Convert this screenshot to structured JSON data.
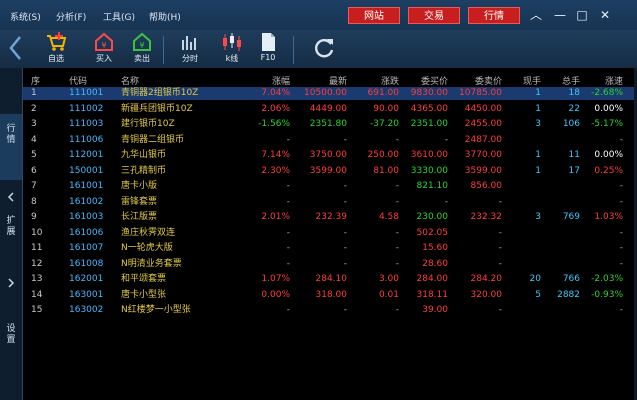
{
  "menu": [
    {
      "label": "系统(S)"
    },
    {
      "label": "分析(F)"
    },
    {
      "label": "工具(G)"
    },
    {
      "label": "帮助(H)"
    }
  ],
  "title_buttons": [
    {
      "label": "网站"
    },
    {
      "label": "交易"
    },
    {
      "label": "行情"
    }
  ],
  "window_controls": {
    "collapse": "︿",
    "minimize": "—",
    "maximize": "□",
    "close": "✕"
  },
  "toolbar": {
    "back_icon": "back-arrow-icon",
    "tools": [
      {
        "label": "自选",
        "icon": "cart-icon"
      },
      {
        "label": "买入",
        "icon": "buy-icon"
      },
      {
        "label": "卖出",
        "icon": "sell-icon"
      },
      {
        "label": "分时",
        "icon": "timeshare-icon"
      },
      {
        "label": "k线",
        "icon": "candlestick-icon"
      },
      {
        "label": "F10",
        "icon": "f10-document-icon"
      }
    ],
    "refresh_icon": "refresh-icon"
  },
  "side_tabs": [
    {
      "label": "行\n情"
    },
    {
      "label": "扩\n展"
    },
    {
      "label": "设\n置"
    }
  ],
  "colors": {
    "red": "#ff3d3d",
    "green": "#2bd42b",
    "selected_row": "#1a3a70",
    "title_button": "#c81e1e"
  },
  "table": {
    "headers": [
      "序",
      "代码",
      "名称",
      "涨幅",
      "最新",
      "涨跌",
      "委买价",
      "委卖价",
      "现手",
      "总手",
      "涨速"
    ],
    "rows": [
      {
        "seq": "1",
        "code": "111001",
        "name": "青铜器2组银币10Z",
        "pct": "7.04%",
        "last": "10500.00",
        "chg": "691.00",
        "bid": "9830.00",
        "ask": "10785.00",
        "vol": "1",
        "tot": "18",
        "spd": "-2.68%",
        "pct_c": "red",
        "last_c": "red",
        "chg_c": "red",
        "bid_c": "red",
        "ask_c": "red",
        "spd_c": "green",
        "tot_c": "cyan",
        "selected": true
      },
      {
        "seq": "2",
        "code": "111002",
        "name": "新疆兵团银币10Z",
        "pct": "2.06%",
        "last": "4449.00",
        "chg": "90.00",
        "bid": "4365.00",
        "ask": "4450.00",
        "vol": "1",
        "tot": "22",
        "spd": "0.00%",
        "pct_c": "red",
        "last_c": "red",
        "chg_c": "red",
        "bid_c": "red",
        "ask_c": "red",
        "spd_c": "white",
        "tot_c": "cyan"
      },
      {
        "seq": "3",
        "code": "111003",
        "name": "建行银币10Z",
        "pct": "-1.56%",
        "last": "2351.80",
        "chg": "-37.20",
        "bid": "2351.00",
        "ask": "2455.00",
        "vol": "3",
        "tot": "106",
        "spd": "-5.17%",
        "pct_c": "green",
        "last_c": "green",
        "chg_c": "green",
        "bid_c": "green",
        "ask_c": "red",
        "spd_c": "green",
        "tot_c": "cyan"
      },
      {
        "seq": "4",
        "code": "111006",
        "name": "青铜器二组银币",
        "pct": "-",
        "last": "-",
        "chg": "-",
        "bid": "-",
        "ask": "2487.00",
        "vol": "",
        "tot": "",
        "spd": "-",
        "pct_c": "gray",
        "last_c": "gray",
        "chg_c": "gray",
        "bid_c": "gray",
        "ask_c": "red",
        "spd_c": "gray",
        "tot_c": "cyan"
      },
      {
        "seq": "5",
        "code": "112001",
        "name": "九华山银币",
        "pct": "7.14%",
        "last": "3750.00",
        "chg": "250.00",
        "bid": "3610.00",
        "ask": "3770.00",
        "vol": "1",
        "tot": "11",
        "spd": "0.00%",
        "pct_c": "red",
        "last_c": "red",
        "chg_c": "red",
        "bid_c": "red",
        "ask_c": "red",
        "spd_c": "white",
        "tot_c": "cyan"
      },
      {
        "seq": "6",
        "code": "150001",
        "name": "三孔精制币",
        "pct": "2.30%",
        "last": "3599.00",
        "chg": "81.00",
        "bid": "3330.00",
        "ask": "3599.00",
        "vol": "1",
        "tot": "17",
        "spd": "0.25%",
        "pct_c": "red",
        "last_c": "red",
        "chg_c": "red",
        "bid_c": "green",
        "ask_c": "red",
        "spd_c": "red",
        "tot_c": "cyan"
      },
      {
        "seq": "7",
        "code": "161001",
        "name": "唐卡小版",
        "pct": "-",
        "last": "-",
        "chg": "-",
        "bid": "821.10",
        "ask": "856.00",
        "vol": "",
        "tot": "",
        "spd": "-",
        "pct_c": "gray",
        "last_c": "gray",
        "chg_c": "gray",
        "bid_c": "green",
        "ask_c": "red",
        "spd_c": "gray",
        "tot_c": "cyan"
      },
      {
        "seq": "8",
        "code": "161002",
        "name": "雷锋套票",
        "pct": "-",
        "last": "-",
        "chg": "-",
        "bid": "-",
        "ask": "-",
        "vol": "",
        "tot": "",
        "spd": "-",
        "pct_c": "gray",
        "last_c": "gray",
        "chg_c": "gray",
        "bid_c": "gray",
        "ask_c": "gray",
        "spd_c": "gray",
        "tot_c": "cyan"
      },
      {
        "seq": "9",
        "code": "161003",
        "name": "长江版票",
        "pct": "2.01%",
        "last": "232.39",
        "chg": "4.58",
        "bid": "230.00",
        "ask": "232.32",
        "vol": "3",
        "tot": "769",
        "spd": "1.03%",
        "pct_c": "red",
        "last_c": "red",
        "chg_c": "red",
        "bid_c": "green",
        "ask_c": "red",
        "spd_c": "red",
        "tot_c": "cyan"
      },
      {
        "seq": "10",
        "code": "161006",
        "name": "渔庄秋霁双连",
        "pct": "-",
        "last": "-",
        "chg": "-",
        "bid": "502.05",
        "ask": "-",
        "vol": "",
        "tot": "",
        "spd": "-",
        "pct_c": "gray",
        "last_c": "gray",
        "chg_c": "gray",
        "bid_c": "red",
        "ask_c": "gray",
        "spd_c": "gray",
        "tot_c": "cyan"
      },
      {
        "seq": "11",
        "code": "161007",
        "name": "N一轮虎大版",
        "pct": "-",
        "last": "-",
        "chg": "-",
        "bid": "15.60",
        "ask": "-",
        "vol": "",
        "tot": "",
        "spd": "-",
        "pct_c": "gray",
        "last_c": "gray",
        "chg_c": "gray",
        "bid_c": "red",
        "ask_c": "gray",
        "spd_c": "gray",
        "tot_c": "cyan"
      },
      {
        "seq": "12",
        "code": "161008",
        "name": "N明清业务套票",
        "pct": "-",
        "last": "-",
        "chg": "-",
        "bid": "28.60",
        "ask": "-",
        "vol": "",
        "tot": "",
        "spd": "-",
        "pct_c": "gray",
        "last_c": "gray",
        "chg_c": "gray",
        "bid_c": "red",
        "ask_c": "gray",
        "spd_c": "gray",
        "tot_c": "cyan"
      },
      {
        "seq": "13",
        "code": "162001",
        "name": "和平颂套票",
        "pct": "1.07%",
        "last": "284.10",
        "chg": "3.00",
        "bid": "284.00",
        "ask": "284.20",
        "vol": "20",
        "tot": "766",
        "spd": "-2.03%",
        "pct_c": "red",
        "last_c": "red",
        "chg_c": "red",
        "bid_c": "red",
        "ask_c": "red",
        "spd_c": "green",
        "tot_c": "cyan"
      },
      {
        "seq": "14",
        "code": "163001",
        "name": "唐卡小型张",
        "pct": "0.00%",
        "last": "318.00",
        "chg": "0.01",
        "bid": "318.11",
        "ask": "320.00",
        "vol": "5",
        "tot": "2882",
        "spd": "-0.93%",
        "pct_c": "red",
        "last_c": "red",
        "chg_c": "red",
        "bid_c": "red",
        "ask_c": "red",
        "spd_c": "green",
        "tot_c": "cyan"
      },
      {
        "seq": "15",
        "code": "163002",
        "name": "N红楼梦一小型张",
        "pct": "-",
        "last": "-",
        "chg": "-",
        "bid": "39.00",
        "ask": "-",
        "vol": "",
        "tot": "",
        "spd": "-",
        "pct_c": "gray",
        "last_c": "gray",
        "chg_c": "gray",
        "bid_c": "red",
        "ask_c": "gray",
        "spd_c": "gray",
        "tot_c": "cyan"
      }
    ]
  }
}
